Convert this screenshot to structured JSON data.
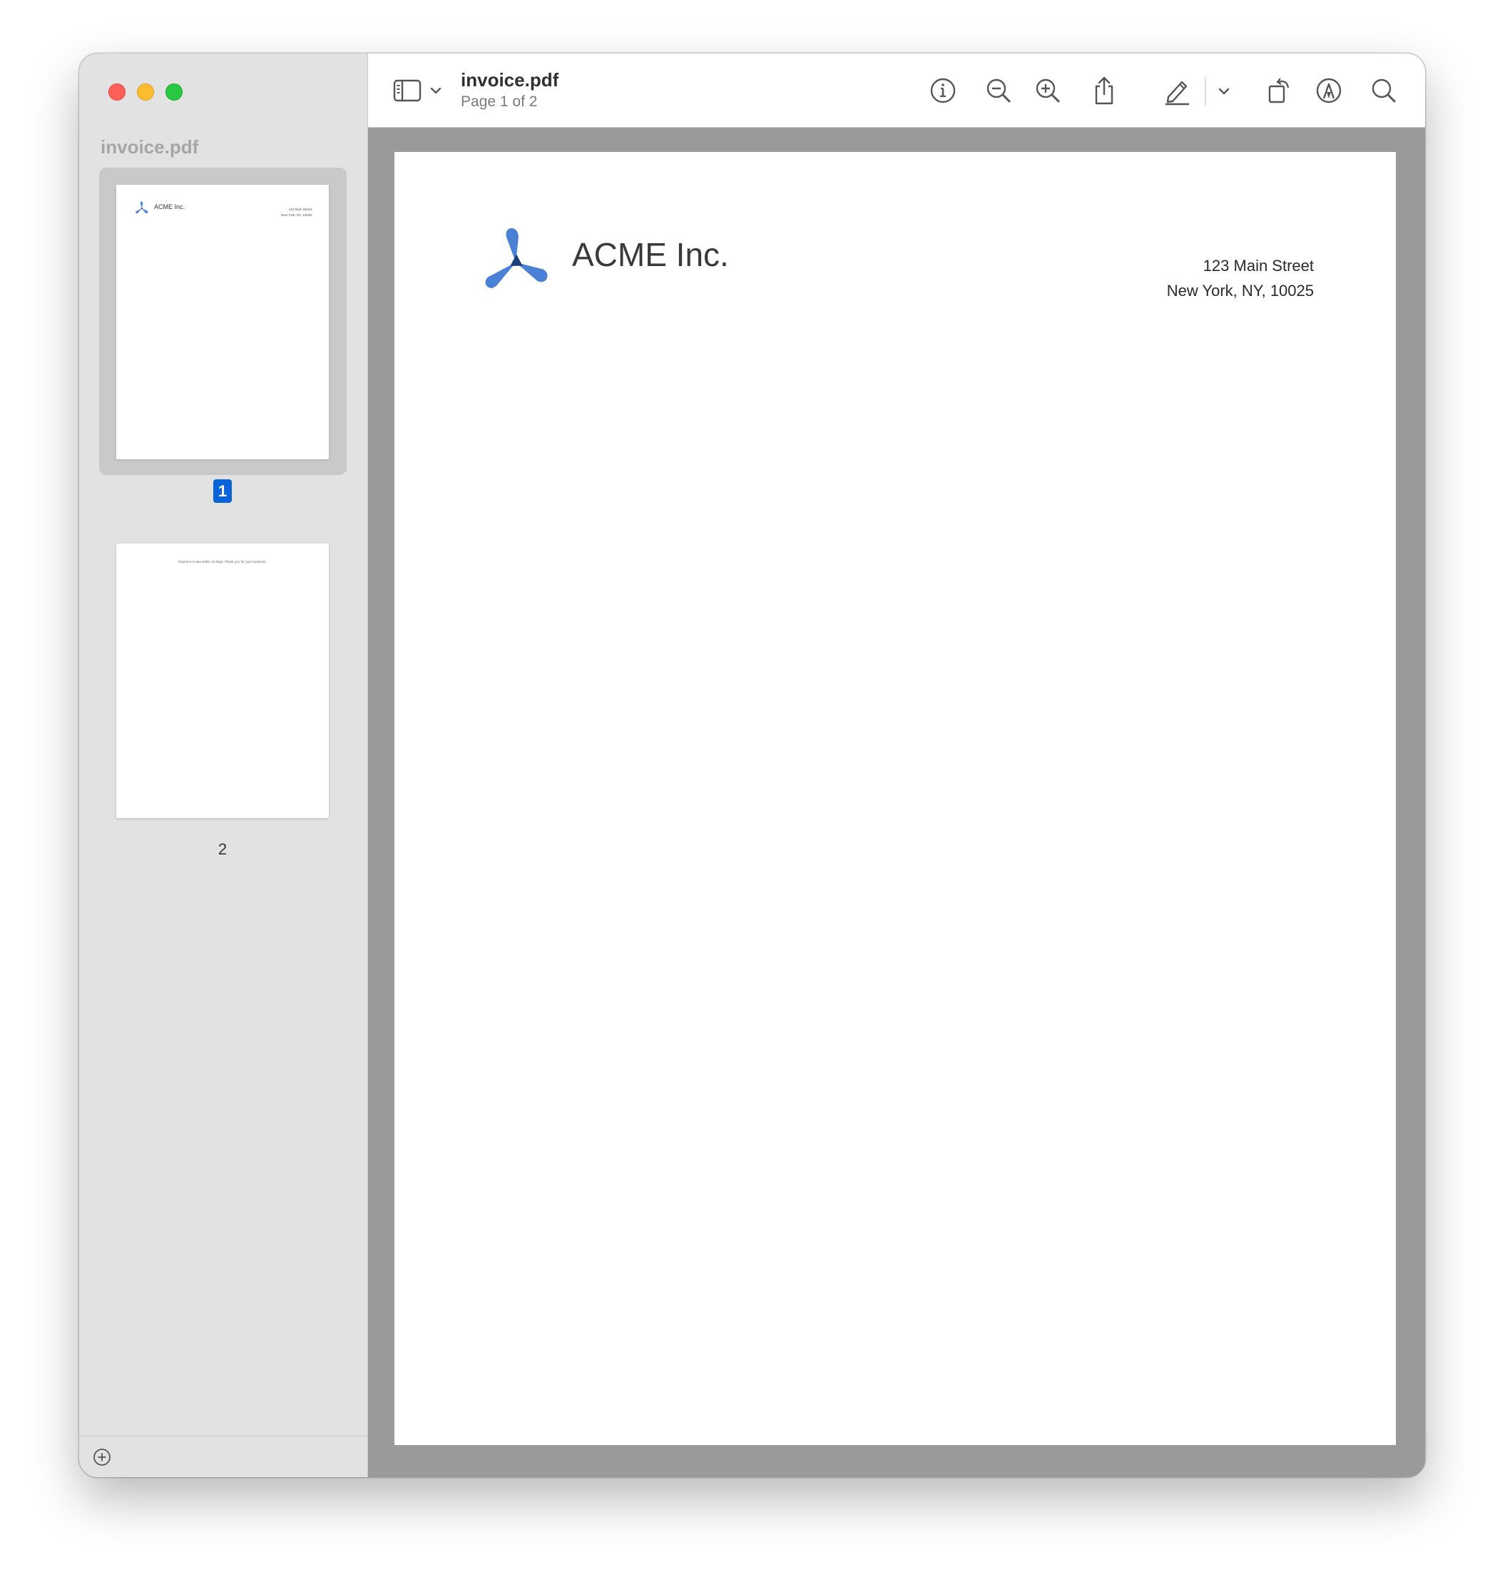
{
  "window": {
    "filename": "invoice.pdf",
    "page_status": "Page 1 of 2"
  },
  "sidebar": {
    "title": "invoice.pdf",
    "pages": [
      {
        "number": "1",
        "selected": true
      },
      {
        "number": "2",
        "selected": false
      }
    ]
  },
  "document": {
    "company": "ACME Inc.",
    "address_line1": "123 Main Street",
    "address_line2": "New York, NY, 10025",
    "page2_note": "Payment is due within 10 days. Thank you for your business."
  },
  "toolbar": {
    "icons": [
      "sidebar-toggle-icon",
      "chevron-down-icon",
      "info-icon",
      "zoom-out-icon",
      "zoom-in-icon",
      "share-icon",
      "markup-pen-icon",
      "chevron-down-icon",
      "rotate-icon",
      "annotate-icon",
      "search-icon"
    ]
  },
  "colors": {
    "accent": "#0a63d8",
    "logo_blue": "#4a80d6",
    "close": "#fe5f57",
    "minimize": "#febc2e",
    "maximize": "#28c840"
  }
}
